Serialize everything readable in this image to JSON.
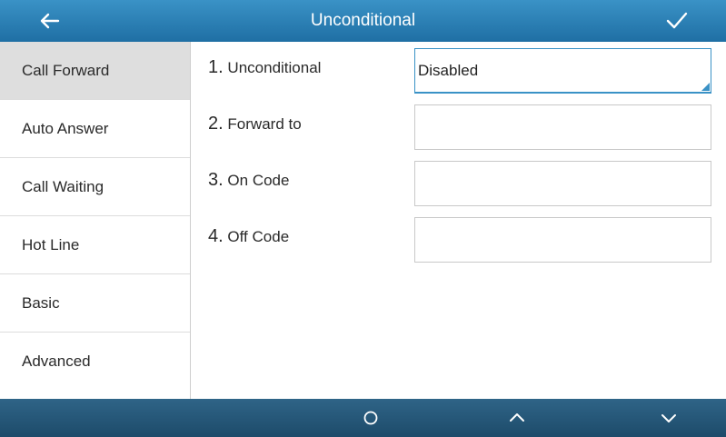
{
  "header": {
    "title": "Unconditional",
    "back_icon": "back-arrow-icon",
    "confirm_icon": "checkmark-icon"
  },
  "sidebar": {
    "items": [
      {
        "label": "Call Forward",
        "selected": true
      },
      {
        "label": "Auto Answer",
        "selected": false
      },
      {
        "label": "Call Waiting",
        "selected": false
      },
      {
        "label": "Hot Line",
        "selected": false
      },
      {
        "label": "Basic",
        "selected": false
      },
      {
        "label": "Advanced",
        "selected": false
      }
    ]
  },
  "form": {
    "rows": [
      {
        "num": "1.",
        "label": "Unconditional",
        "value": "Disabled",
        "type": "select"
      },
      {
        "num": "2.",
        "label": "Forward to",
        "value": "",
        "type": "text"
      },
      {
        "num": "3.",
        "label": "On Code",
        "value": "",
        "type": "text"
      },
      {
        "num": "4.",
        "label": "Off Code",
        "value": "",
        "type": "text"
      }
    ]
  },
  "softkeys": [
    {
      "icon": "circle-icon"
    },
    {
      "icon": "chevron-up-icon"
    },
    {
      "icon": "chevron-down-icon"
    }
  ],
  "colors": {
    "titlebar": "#2a82b8",
    "softbar": "#264f6d",
    "accent": "#3a92c6",
    "selected_item": "#dedede"
  }
}
